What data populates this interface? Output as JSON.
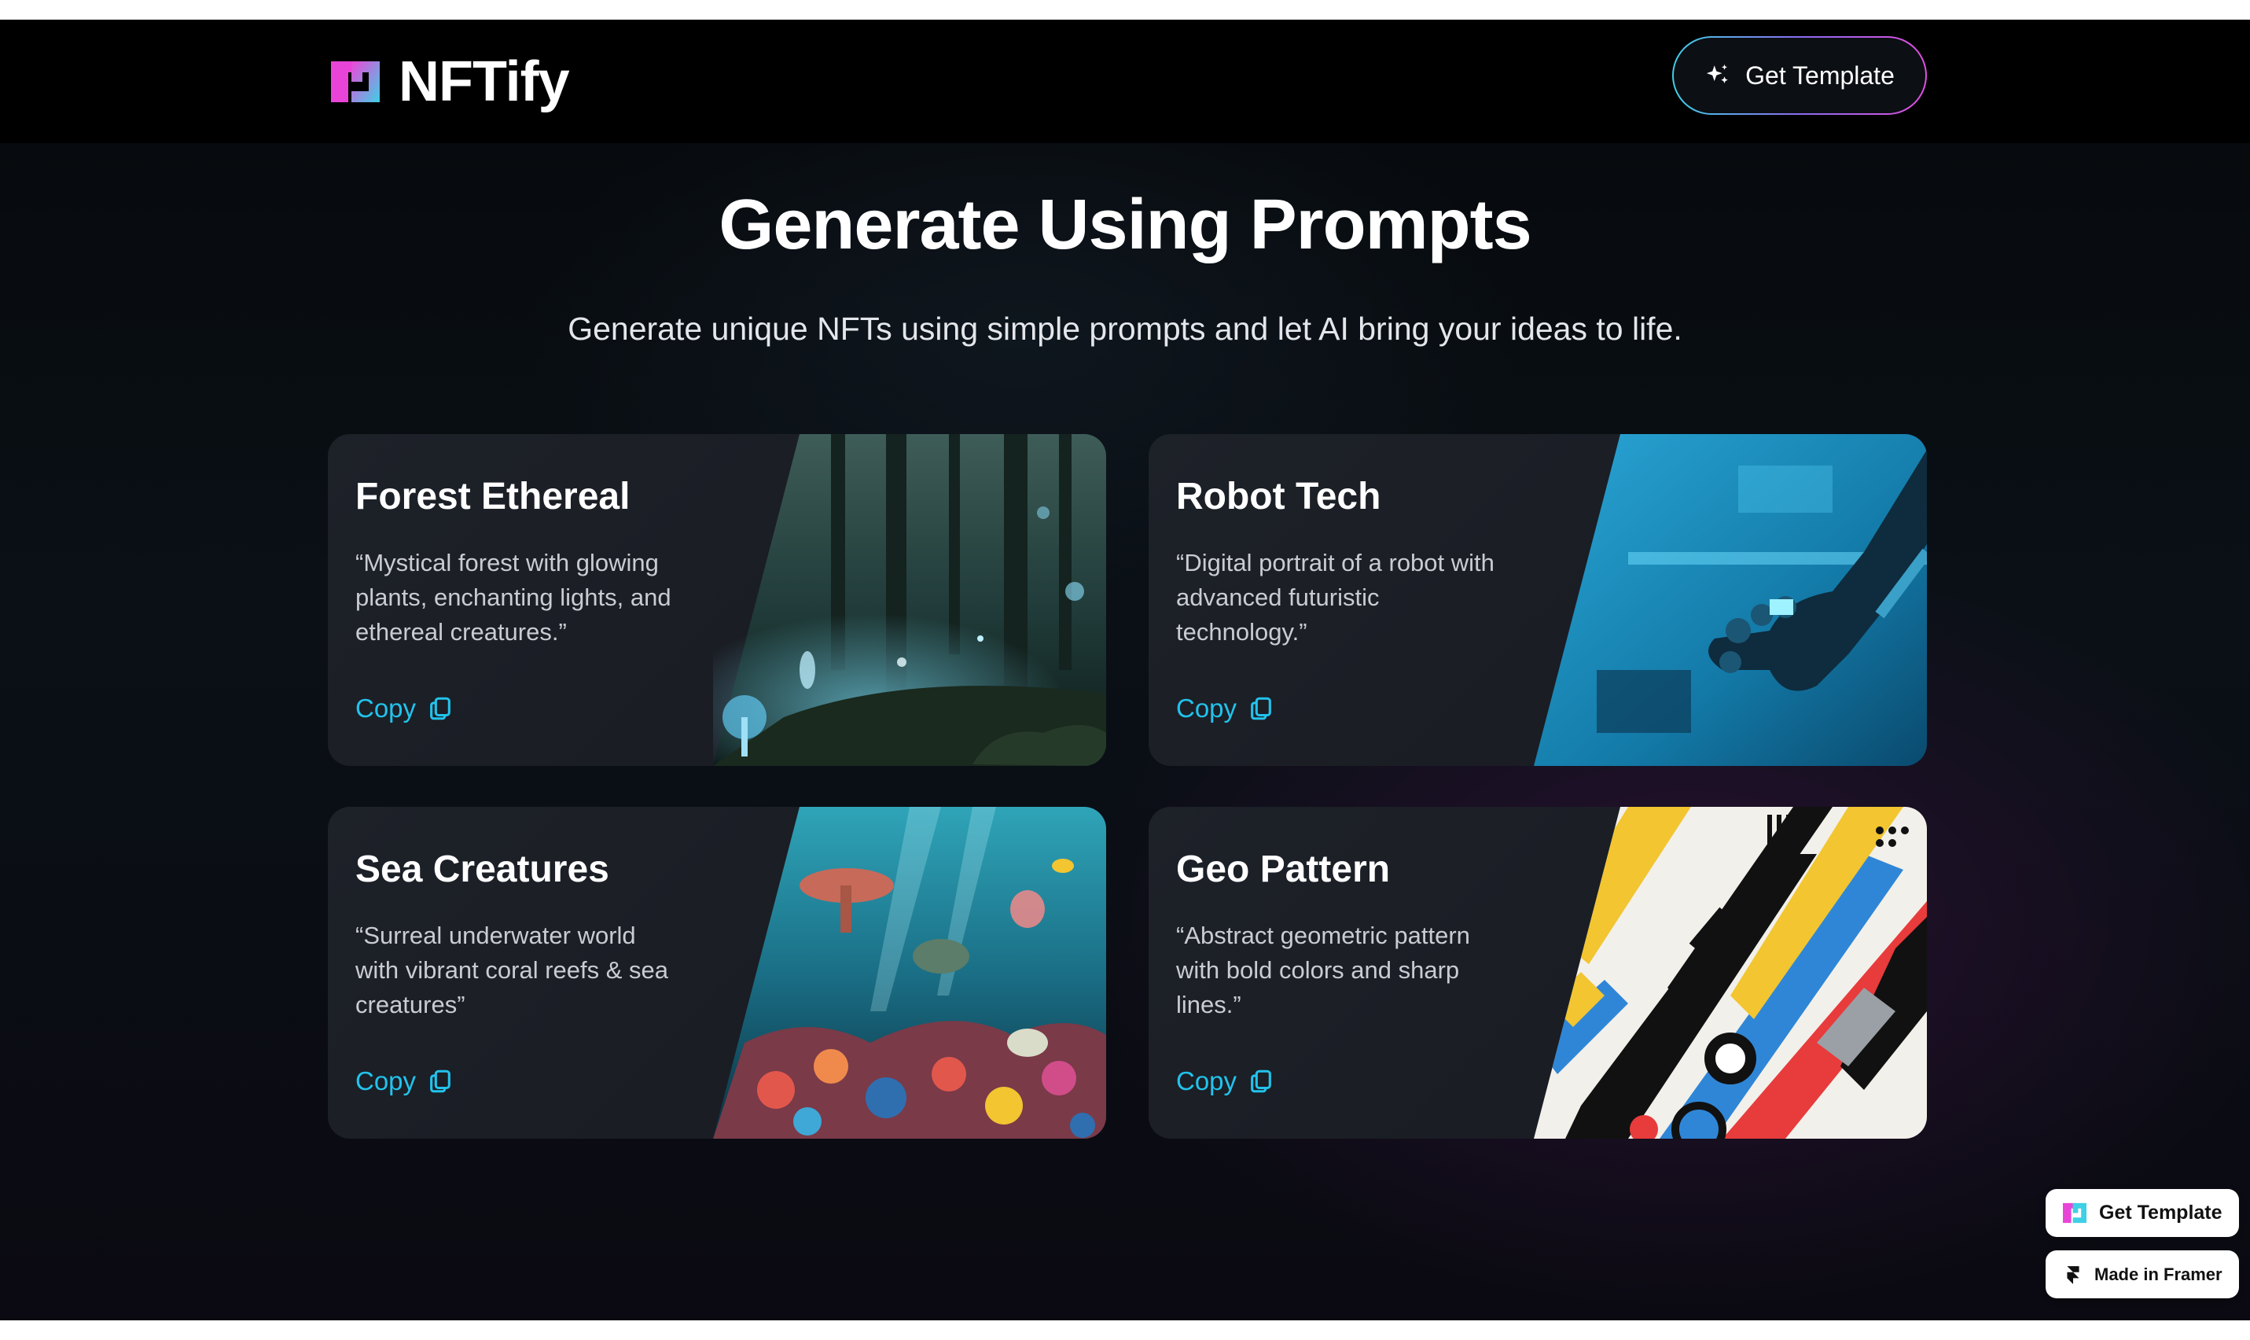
{
  "brand": {
    "name": "NFTify"
  },
  "nav": {
    "cta_label": "Get Template"
  },
  "hero": {
    "title": "Generate Using Prompts",
    "subtitle": "Generate unique NFTs using simple prompts and let AI bring your ideas to life."
  },
  "cards": [
    {
      "title": "Forest Ethereal",
      "description": "“Mystical forest with glowing plants, enchanting lights, and ethereal creatures.”",
      "copy_label": "Copy"
    },
    {
      "title": "Robot Tech",
      "description": "“Digital portrait of a robot with advanced futuristic technology.”",
      "copy_label": "Copy"
    },
    {
      "title": "Sea Creatures",
      "description": "“Surreal underwater world with vibrant coral reefs & sea creatures”",
      "copy_label": "Copy"
    },
    {
      "title": "Geo Pattern",
      "description": "“Abstract geometric pattern with bold colors and sharp lines.”",
      "copy_label": "Copy"
    }
  ],
  "badges": {
    "get_template": "Get Template",
    "made_in_framer": "Made in Framer"
  },
  "colors": {
    "accent": "#22c3ec",
    "brand_magenta": "#e24ee0",
    "brand_cyan": "#3fd0e6",
    "background": "#0a1016"
  },
  "icons": {
    "sparkle": "sparkle-icon",
    "copy": "copy-icon",
    "logo": "nftify-logo-icon",
    "framer": "framer-logo-icon"
  }
}
